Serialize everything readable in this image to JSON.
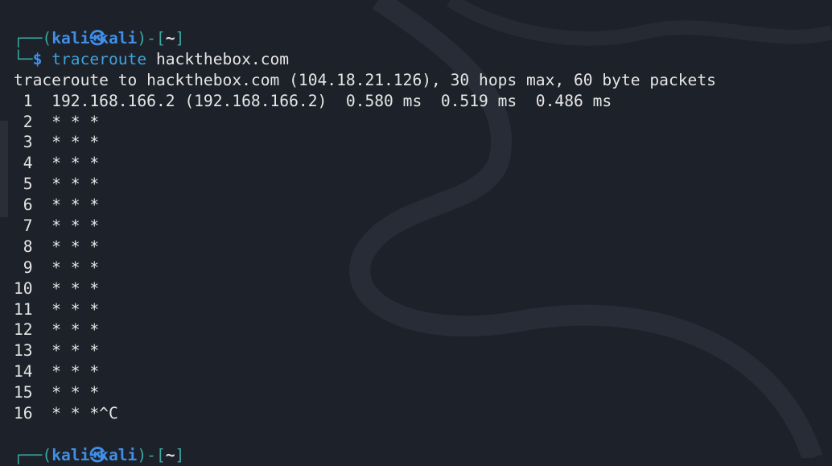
{
  "prompt": {
    "user": "kali",
    "host": "kali",
    "cwd": "~",
    "symbol": "$"
  },
  "command": {
    "name": "traceroute",
    "args": "hackthebox.com"
  },
  "output_header": "traceroute to hackthebox.com (104.18.21.126), 30 hops max, 60 byte packets",
  "hops": [
    " 1  192.168.166.2 (192.168.166.2)  0.580 ms  0.519 ms  0.486 ms",
    " 2  * * *",
    " 3  * * *",
    " 4  * * *",
    " 5  * * *",
    " 6  * * *",
    " 7  * * *",
    " 8  * * *",
    " 9  * * *",
    "10  * * *",
    "11  * * *",
    "12  * * *",
    "13  * * *",
    "14  * * *",
    "15  * * *",
    "16  * * *^C"
  ],
  "colors": {
    "background": "#1d2129",
    "prompt_frame": "#3aa8a0",
    "prompt_user": "#3f8fe8",
    "command": "#3ea3da",
    "text": "#e6e6e6"
  }
}
